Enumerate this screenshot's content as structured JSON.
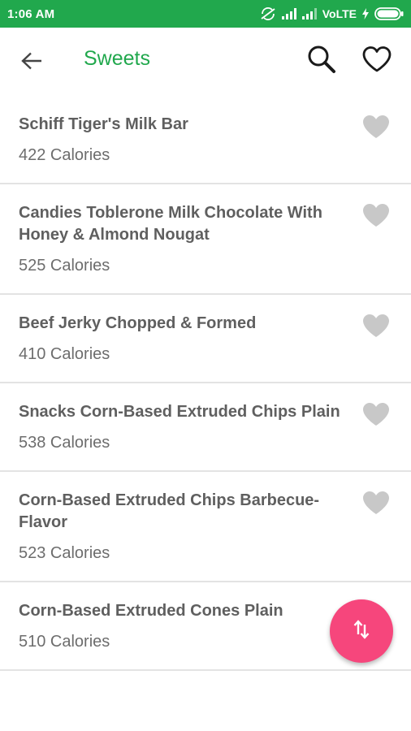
{
  "status_bar": {
    "time": "1:06 AM",
    "network": "VoLTE",
    "background_color": "#21a84d"
  },
  "app_bar": {
    "title": "Sweets",
    "title_color": "#21a84d",
    "back_icon": "arrow-left-icon",
    "search_icon": "search-icon",
    "favorites_icon": "heart-outline-icon"
  },
  "food_list": {
    "items": [
      {
        "name": "Schiff Tiger's Milk Bar",
        "calories": "422 Calories"
      },
      {
        "name": "Candies Toblerone Milk Chocolate With Honey & Almond Nougat",
        "calories": "525 Calories"
      },
      {
        "name": "Beef Jerky Chopped & Formed",
        "calories": "410 Calories"
      },
      {
        "name": "Snacks Corn-Based Extruded Chips Plain",
        "calories": "538 Calories"
      },
      {
        "name": "Corn-Based Extruded Chips Barbecue-Flavor",
        "calories": "523 Calories"
      },
      {
        "name": "Corn-Based Extruded Cones Plain",
        "calories": "510 Calories"
      }
    ],
    "favorite_icon": "heart-filled-icon",
    "favorite_icon_color": "#c8c8c8"
  },
  "fab": {
    "icon": "sort-arrows-icon",
    "color": "#f6467c"
  }
}
